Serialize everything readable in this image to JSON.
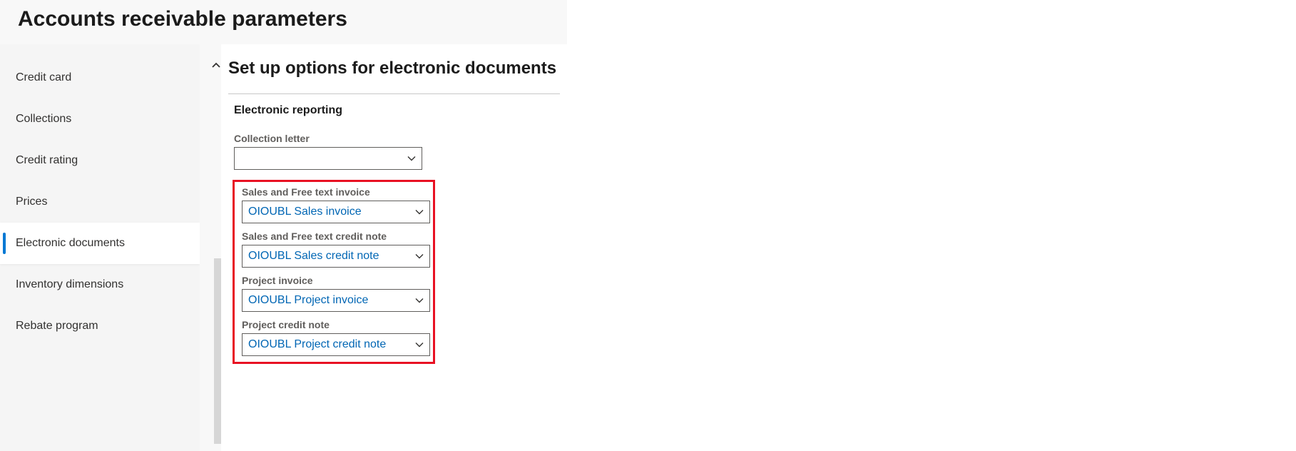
{
  "page": {
    "title": "Accounts receivable parameters"
  },
  "sidebar": {
    "items": [
      {
        "label": "Credit card"
      },
      {
        "label": "Collections"
      },
      {
        "label": "Credit rating"
      },
      {
        "label": "Prices"
      },
      {
        "label": "Electronic documents"
      },
      {
        "label": "Inventory dimensions"
      },
      {
        "label": "Rebate program"
      }
    ]
  },
  "content": {
    "section_title": "Set up options for electronic documents",
    "group_title": "Electronic reporting",
    "fields": {
      "collection_letter": {
        "label": "Collection letter",
        "value": ""
      },
      "sales_free_text_invoice": {
        "label": "Sales and Free text invoice",
        "value": "OIOUBL Sales invoice"
      },
      "sales_free_text_credit_note": {
        "label": "Sales and Free text credit note",
        "value": "OIOUBL Sales credit note"
      },
      "project_invoice": {
        "label": "Project invoice",
        "value": "OIOUBL Project invoice"
      },
      "project_credit_note": {
        "label": "Project credit note",
        "value": "OIOUBL Project credit note"
      }
    }
  }
}
